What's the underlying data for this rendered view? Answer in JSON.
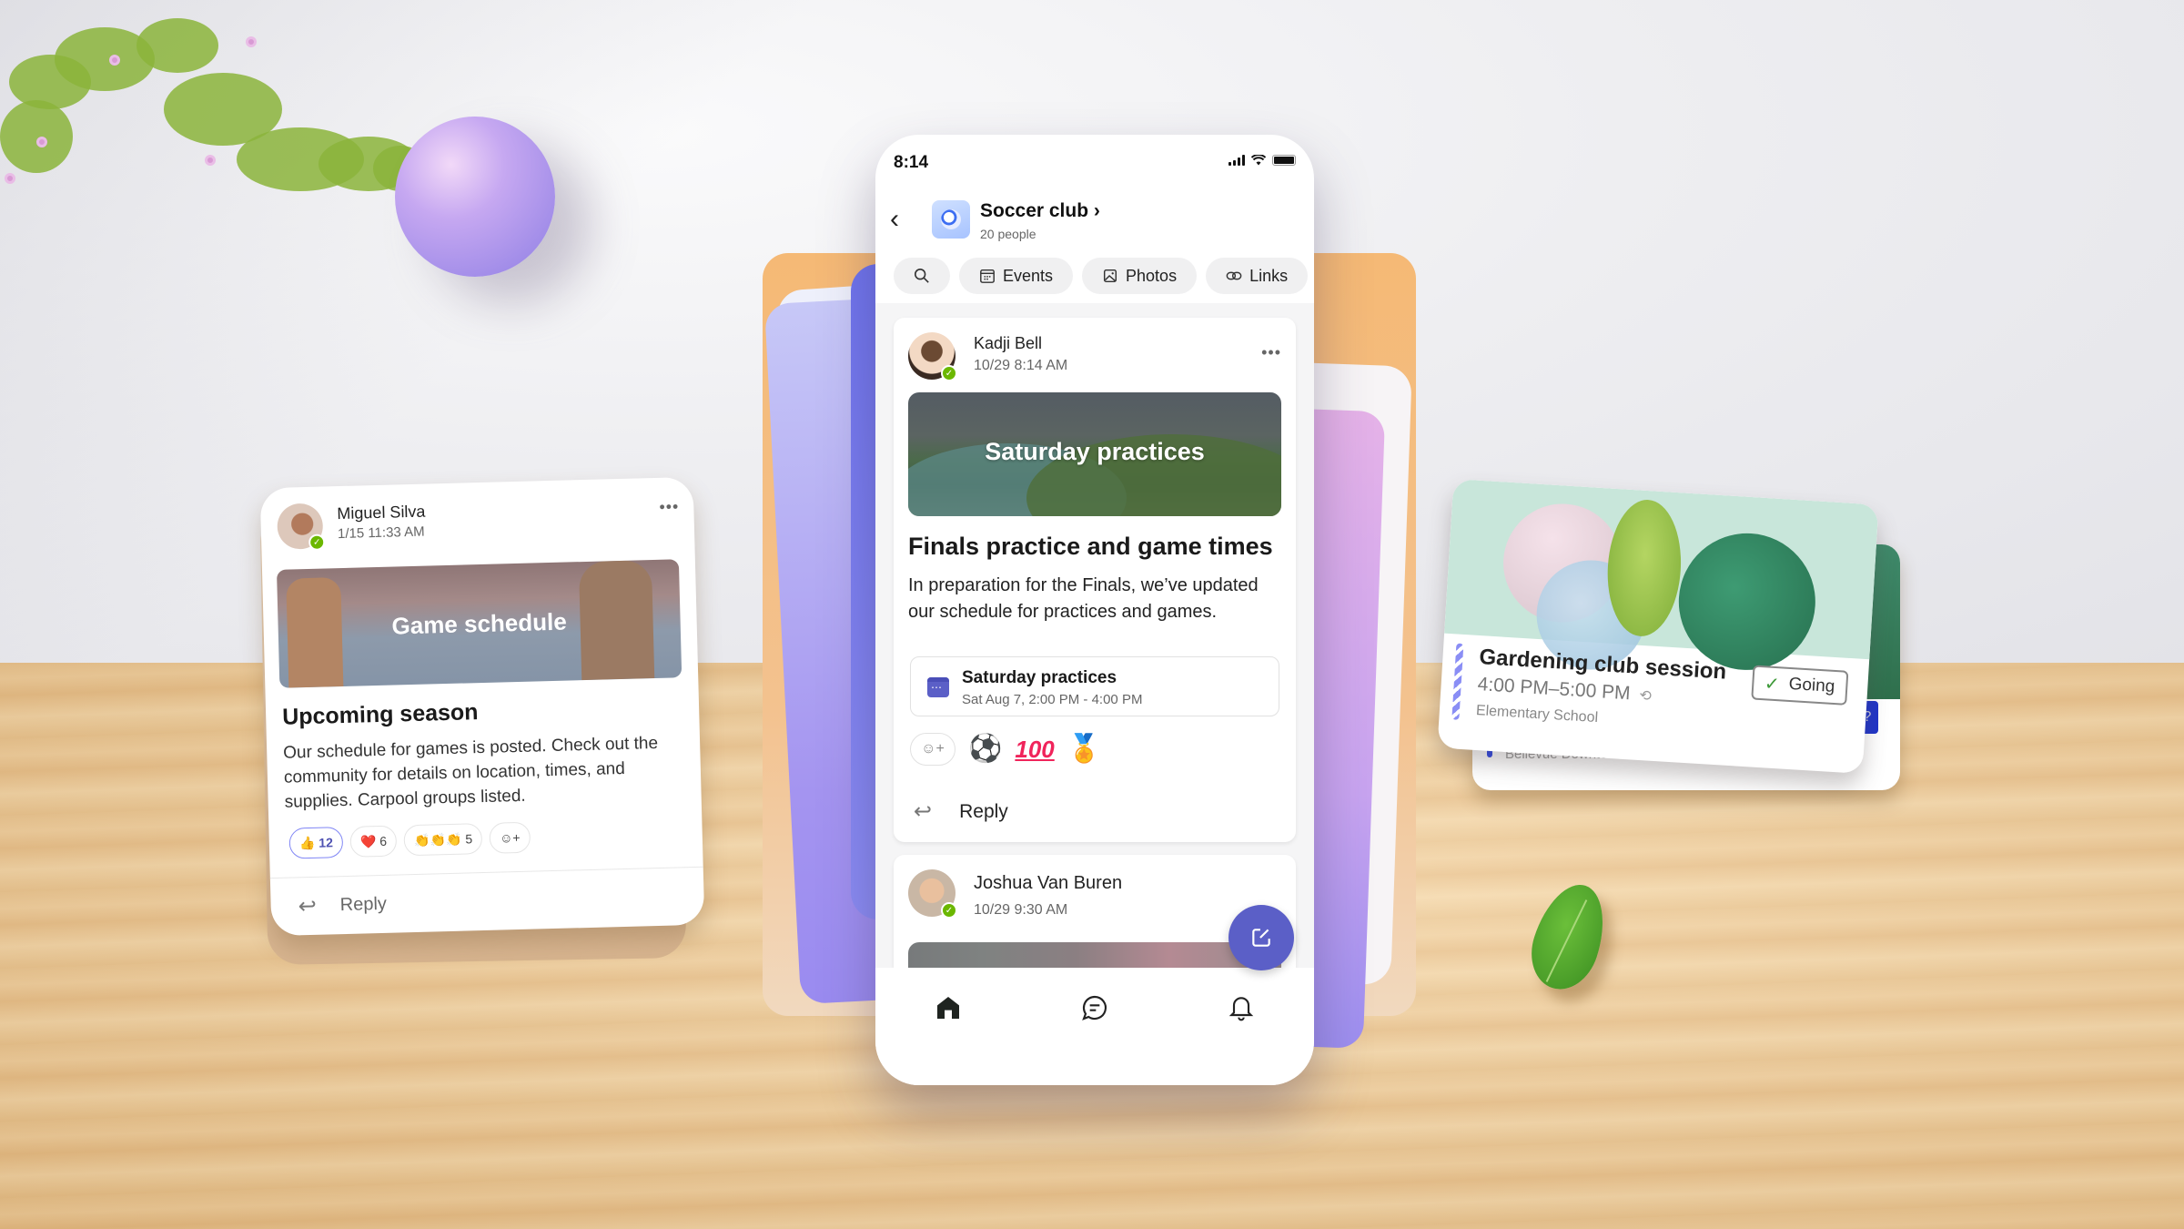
{
  "phone": {
    "status_bar": {
      "time": "8:14",
      "icons": [
        "cellular-signal-icon",
        "wifi-icon",
        "battery-icon"
      ]
    },
    "header": {
      "back_icon": "chevron-left-icon",
      "group_name": "Soccer club",
      "group_chevron": "›",
      "member_count": "20 people"
    },
    "chips": [
      {
        "icon": "search-icon",
        "label": ""
      },
      {
        "icon": "calendar-icon",
        "label": "Events"
      },
      {
        "icon": "image-icon",
        "label": "Photos"
      },
      {
        "icon": "link-icon",
        "label": "Links"
      }
    ],
    "posts": [
      {
        "author": "Kadji Bell",
        "timestamp": "10/29 8:14 AM",
        "more": "•••",
        "banner_title": "Saturday practices",
        "title": "Finals practice and game times",
        "body": "In preparation for the Finals, we’ve updated our schedule for practices and games.",
        "event": {
          "title": "Saturday practices",
          "time": "Sat Aug 7, 2:00 PM - 4:00 PM"
        },
        "reactions": [
          "⚽",
          "💯",
          "🏅"
        ],
        "reply_label": "Reply"
      },
      {
        "author": "Joshua Van Buren",
        "timestamp": "10/29 9:30 AM"
      }
    ],
    "fab_icon": "compose-icon",
    "bottom_nav": [
      {
        "icon": "home-icon",
        "active": true
      },
      {
        "icon": "chat-icon",
        "active": false
      },
      {
        "icon": "bell-icon",
        "active": false
      }
    ]
  },
  "left_card": {
    "author": "Miguel Silva",
    "timestamp": "1/15 11:33 AM",
    "more": "•••",
    "banner_title": "Game schedule",
    "title": "Upcoming season",
    "body": "Our schedule for games is posted. Check out the community for details on location, times, and supplies. Carpool groups listed.",
    "reactions": [
      {
        "emoji": "👍",
        "count": "12",
        "mine": true
      },
      {
        "emoji": "❤️",
        "count": "6",
        "mine": false
      },
      {
        "emoji": "👏👏👏",
        "count": "5",
        "mine": false
      }
    ],
    "reply_label": "Reply"
  },
  "right_card": {
    "title": "Gardening club session",
    "time": "4:00 PM–5:00 PM",
    "repeat_icon": "⟲",
    "location": "Elementary School",
    "rsvp_label": "Going",
    "back_card": {
      "location": "Bellevue Downtown Park",
      "badge": "?"
    }
  },
  "colors": {
    "brand": "#5b5fc7",
    "presence": "#6bb700",
    "wall": "#ececef",
    "table": "#ecc896"
  }
}
